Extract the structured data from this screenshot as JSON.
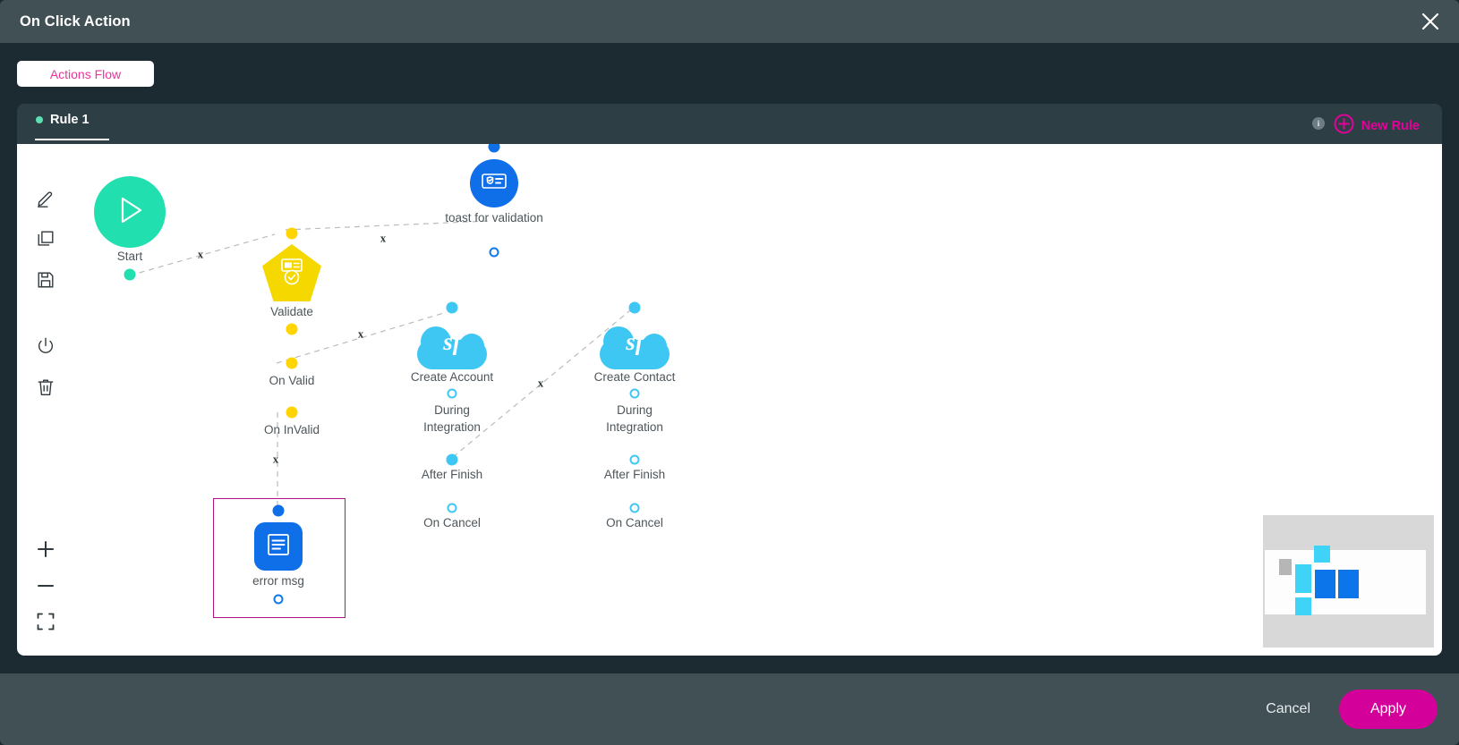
{
  "window": {
    "title": "On Click Action",
    "close_icon": "close-icon"
  },
  "subheader": {
    "actions_flow_label": "Actions Flow"
  },
  "tabs": {
    "items": [
      {
        "label": "Rule 1",
        "status_dot_color": "#5ce0b0",
        "active": true
      }
    ],
    "info_badge": "i",
    "new_rule_label": "New Rule",
    "new_rule_icon": "plus-circle-icon"
  },
  "toolbar": {
    "items": [
      {
        "name": "edit-tool",
        "icon": "pencil-icon"
      },
      {
        "name": "copy-tool",
        "icon": "copy-icon"
      },
      {
        "name": "save-tool",
        "icon": "save-icon"
      },
      {
        "name": "power-tool",
        "icon": "power-icon"
      },
      {
        "name": "delete-tool",
        "icon": "trash-icon"
      }
    ],
    "zoom": [
      {
        "name": "zoom-in",
        "icon": "plus-icon"
      },
      {
        "name": "zoom-out",
        "icon": "minus-icon"
      },
      {
        "name": "fit-view",
        "icon": "fit-screen-icon"
      }
    ]
  },
  "flow": {
    "nodes": {
      "start": {
        "label": "Start",
        "icon": "play-icon",
        "color": "#22dfb0"
      },
      "validate": {
        "label": "Validate",
        "icon": "validate-badge-icon",
        "color": "#f5d800"
      },
      "toast": {
        "label": "toast for validation",
        "icon": "toast-card-icon",
        "color": "#0f6fe8"
      },
      "create_account": {
        "label": "Create Account",
        "icon": "salesforce-cloud-icon",
        "color": "#3fc7f4",
        "badge": "sf"
      },
      "create_contact": {
        "label": "Create Contact",
        "icon": "salesforce-cloud-icon",
        "color": "#3fc7f4",
        "badge": "sf"
      },
      "error_msg": {
        "label": "error msg",
        "icon": "message-icon",
        "color": "#0f6fe8",
        "selected": true
      }
    },
    "ports": {
      "on_valid": "On Valid",
      "on_invalid": "On InValid",
      "during_integration": "During\nIntegration",
      "during_integration_line1": "During",
      "during_integration_line2": "Integration",
      "after_finish": "After Finish",
      "on_cancel": "On Cancel"
    },
    "edge_label": "x",
    "selection_color": "#b3137f"
  },
  "footer": {
    "cancel_label": "Cancel",
    "apply_label": "Apply",
    "apply_color": "#d4009a"
  }
}
